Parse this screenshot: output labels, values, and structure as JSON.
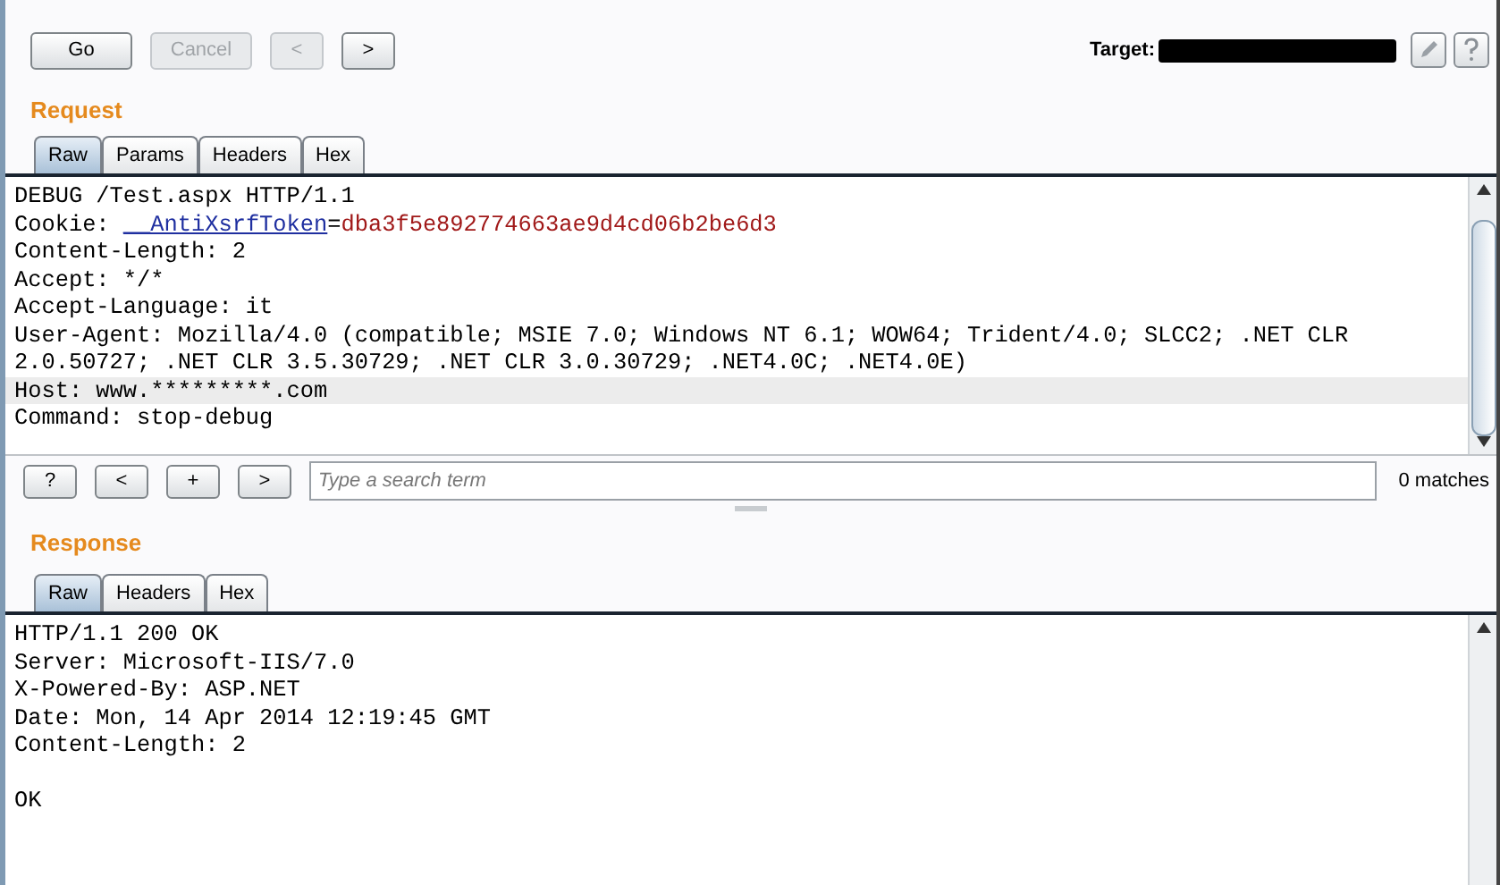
{
  "toolbar": {
    "buttons": [
      {
        "label": "Go",
        "disabled": false
      },
      {
        "label": "Cancel",
        "disabled": true
      },
      {
        "label": "<",
        "disabled": true
      },
      {
        "label": ">",
        "disabled": false
      }
    ],
    "target_label": "Target:"
  },
  "request": {
    "title": "Request",
    "tabs": [
      {
        "label": "Raw",
        "selected": true
      },
      {
        "label": "Params",
        "selected": false
      },
      {
        "label": "Headers",
        "selected": false
      },
      {
        "label": "Hex",
        "selected": false
      }
    ],
    "lines": [
      {
        "highlighted": false,
        "parts": [
          {
            "kind": "plain",
            "text": "DEBUG /Test.aspx HTTP/1.1"
          }
        ]
      },
      {
        "highlighted": false,
        "parts": [
          {
            "kind": "plain",
            "text": "Cookie: "
          },
          {
            "kind": "name",
            "text": "__AntiXsrfToken"
          },
          {
            "kind": "plain",
            "text": "="
          },
          {
            "kind": "value",
            "text": "dba3f5e892774663ae9d4cd06b2be6d3"
          }
        ]
      },
      {
        "highlighted": false,
        "parts": [
          {
            "kind": "plain",
            "text": "Content-Length: 2"
          }
        ]
      },
      {
        "highlighted": false,
        "parts": [
          {
            "kind": "plain",
            "text": "Accept: */*"
          }
        ]
      },
      {
        "highlighted": false,
        "parts": [
          {
            "kind": "plain",
            "text": "Accept-Language: it"
          }
        ]
      },
      {
        "highlighted": false,
        "parts": [
          {
            "kind": "plain",
            "text": "User-Agent: Mozilla/4.0 (compatible; MSIE 7.0; Windows NT 6.1; WOW64; Trident/4.0; SLCC2; .NET CLR"
          }
        ]
      },
      {
        "highlighted": false,
        "parts": [
          {
            "kind": "plain",
            "text": "2.0.50727; .NET CLR 3.5.30729; .NET CLR 3.0.30729; .NET4.0C; .NET4.0E)"
          }
        ]
      },
      {
        "highlighted": true,
        "parts": [
          {
            "kind": "plain",
            "text": "Host: www.*********.com"
          }
        ]
      },
      {
        "highlighted": false,
        "parts": [
          {
            "kind": "plain",
            "text": "Command: stop-debug"
          }
        ]
      }
    ],
    "search": {
      "buttons": [
        "?",
        "<",
        "+",
        ">"
      ],
      "placeholder": "Type a search term",
      "matches": "0 matches"
    }
  },
  "response": {
    "title": "Response",
    "tabs": [
      {
        "label": "Raw",
        "selected": true
      },
      {
        "label": "Headers",
        "selected": false
      },
      {
        "label": "Hex",
        "selected": false
      }
    ],
    "header_lines": [
      "HTTP/1.1 200 OK",
      "Server: Microsoft-IIS/7.0",
      "X-Powered-By: ASP.NET",
      "Date: Mon, 14 Apr 2014 12:19:45 GMT",
      "Content-Length: 2"
    ],
    "body_lines": [
      "OK"
    ]
  }
}
